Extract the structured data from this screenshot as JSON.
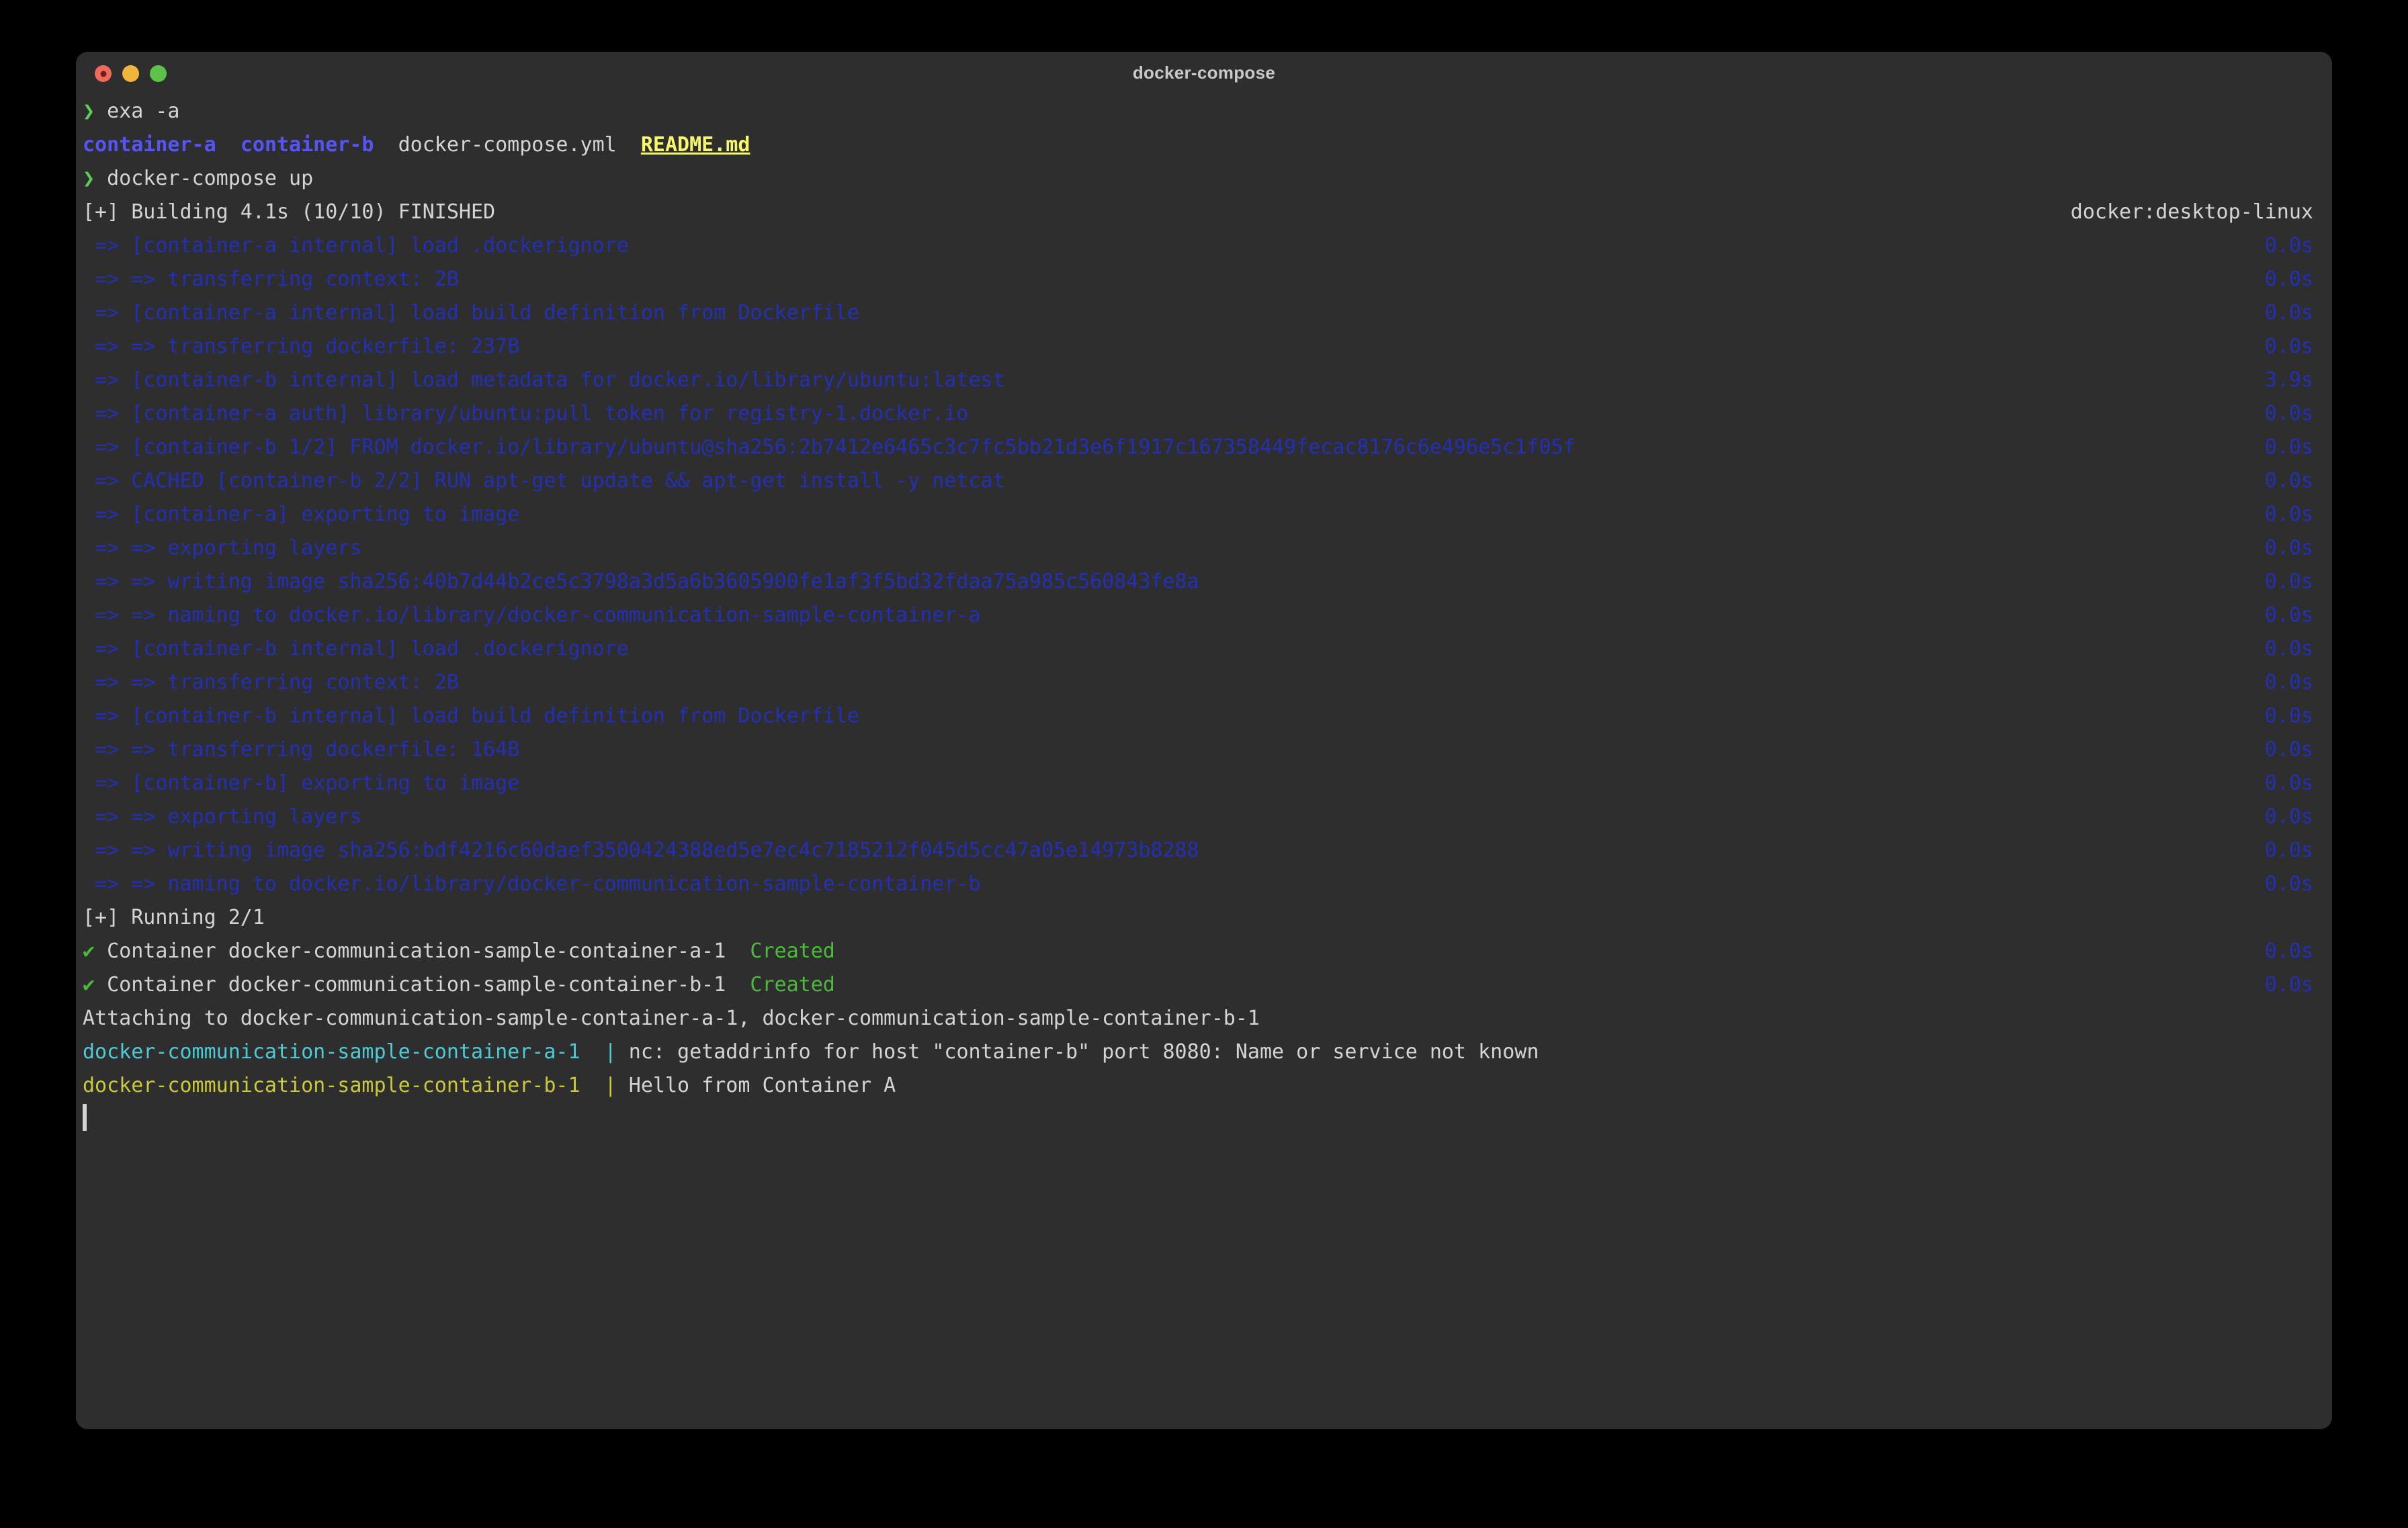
{
  "window": {
    "title": "docker-compose",
    "traffic_lights": [
      "close",
      "minimize",
      "maximize"
    ]
  },
  "terminal": {
    "prompt_symbol": "❯",
    "commands": [
      {
        "prompt": "❯",
        "text": "exa -a"
      },
      {
        "prompt": "❯",
        "text": "docker-compose up"
      }
    ],
    "ls_output": {
      "dir_a": "container-a",
      "dir_b": "container-b",
      "file_yml": "docker-compose.yml",
      "file_md": "README.md"
    },
    "build_header": {
      "text": "[+] Building 4.1s (10/10) FINISHED",
      "builder": "docker:desktop-linux"
    },
    "build_steps": [
      {
        "text": " => [container-a internal] load .dockerignore",
        "time": "0.0s"
      },
      {
        "text": " => => transferring context: 2B",
        "time": "0.0s"
      },
      {
        "text": " => [container-a internal] load build definition from Dockerfile",
        "time": "0.0s"
      },
      {
        "text": " => => transferring dockerfile: 237B",
        "time": "0.0s"
      },
      {
        "text": " => [container-b internal] load metadata for docker.io/library/ubuntu:latest",
        "time": "3.9s"
      },
      {
        "text": " => [container-a auth] library/ubuntu:pull token for registry-1.docker.io",
        "time": "0.0s"
      },
      {
        "text": " => [container-b 1/2] FROM docker.io/library/ubuntu@sha256:2b7412e6465c3c7fc5bb21d3e6f1917c167358449fecac8176c6e496e5c1f05f",
        "time": "0.0s"
      },
      {
        "text": " => CACHED [container-b 2/2] RUN apt-get update && apt-get install -y netcat",
        "time": "0.0s"
      },
      {
        "text": " => [container-a] exporting to image",
        "time": "0.0s"
      },
      {
        "text": " => => exporting layers",
        "time": "0.0s"
      },
      {
        "text": " => => writing image sha256:40b7d44b2ce5c3798a3d5a6b3605900fe1af3f5bd32fdaa75a985c560843fe8a",
        "time": "0.0s"
      },
      {
        "text": " => => naming to docker.io/library/docker-communication-sample-container-a",
        "time": "0.0s"
      },
      {
        "text": " => [container-b internal] load .dockerignore",
        "time": "0.0s"
      },
      {
        "text": " => => transferring context: 2B",
        "time": "0.0s"
      },
      {
        "text": " => [container-b internal] load build definition from Dockerfile",
        "time": "0.0s"
      },
      {
        "text": " => => transferring dockerfile: 164B",
        "time": "0.0s"
      },
      {
        "text": " => [container-b] exporting to image",
        "time": "0.0s"
      },
      {
        "text": " => => exporting layers",
        "time": "0.0s"
      },
      {
        "text": " => => writing image sha256:bdf4216c60daef3500424388ed5e7ec4c7185212f045d5cc47a05e14973b8288",
        "time": "0.0s"
      },
      {
        "text": " => => naming to docker.io/library/docker-communication-sample-container-b",
        "time": "0.0s"
      }
    ],
    "running_header": "[+] Running 2/1",
    "containers": [
      {
        "check": "✔",
        "label": " Container docker-communication-sample-container-a-1",
        "status": "Created",
        "time": "0.0s"
      },
      {
        "check": "✔",
        "label": " Container docker-communication-sample-container-b-1",
        "status": "Created",
        "time": "0.0s"
      }
    ],
    "attaching_line": "Attaching to docker-communication-sample-container-a-1, docker-communication-sample-container-b-1",
    "logs": [
      {
        "prefix": "docker-communication-sample-container-a-1",
        "separator": "|",
        "message": "nc: getaddrinfo for host \"container-b\" port 8080: Name or service not known",
        "color": "cyan"
      },
      {
        "prefix": "docker-communication-sample-container-b-1",
        "separator": "|",
        "message": "Hello from Container A",
        "color": "yellow"
      }
    ]
  },
  "colors": {
    "background": "#2e2e2e",
    "foreground": "#d4d4d4",
    "dim_blue": "#2330b5",
    "green": "#4cbb3c",
    "cyan": "#4ec9d6",
    "yellow": "#c9c93a",
    "dir_blue": "#5555f7",
    "md_yellow": "#f7f76a"
  }
}
